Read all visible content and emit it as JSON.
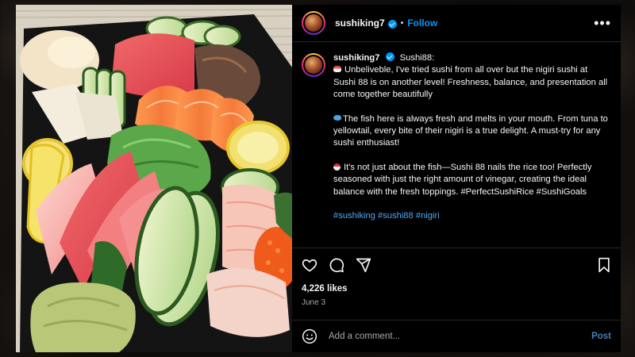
{
  "post": {
    "username": "sushiking7",
    "follow_label": "Follow",
    "more_icon": "more-horizontal-icon",
    "caption": {
      "title": "Sushi88:",
      "p1": "Unbeliveble, I've tried sushi from all over but the nigiri sushi at Sushi 88 is on another level! Freshness, balance, and presentation all come together beautifully",
      "p2": "The fish here is always fresh and melts in your mouth. From tuna to yellowtail, every bite of their nigiri is a true delight. A must-try for any sushi enthusiast!",
      "p3": "It's not just about the fish—Sushi 88 nails the rice too! Perfectly seasoned with just the right amount of vinegar, creating the ideal balance with the fresh toppings. #PerfectSushiRice #SushiGoals",
      "hashtags": "#sushiking #sushi88 #nigiri"
    },
    "likes": "4,226 likes",
    "date": "June 3",
    "comment_placeholder": "Add a comment...",
    "post_label": "Post"
  },
  "colors": {
    "accent": "#0095f6",
    "hashtag": "#4fa8f6",
    "background": "#000000",
    "post_button": "#4a7fb0"
  }
}
